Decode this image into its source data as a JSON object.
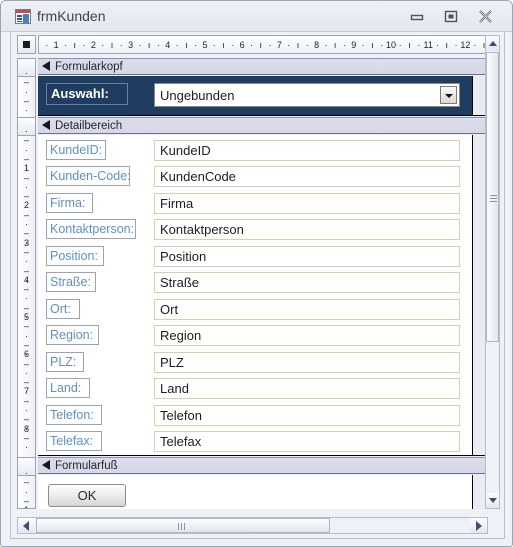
{
  "window": {
    "title": "frmKunden",
    "icon": "access-form-icon",
    "controls": {
      "minimize": "minimize-button",
      "restore": "restore-button",
      "close": "close-button"
    }
  },
  "rulers": {
    "horizontal_numbers": [
      1,
      2,
      3,
      4,
      5,
      6,
      7,
      8,
      9,
      10,
      11,
      12
    ],
    "vertical_numbers_detail": [
      1,
      2,
      3,
      4,
      5,
      6,
      7,
      8
    ],
    "vertical_numbers_footer": [
      1
    ],
    "unit": "cm"
  },
  "sections": [
    {
      "id": "header",
      "label": "Formularkopf"
    },
    {
      "id": "detail",
      "label": "Detailbereich"
    },
    {
      "id": "footer",
      "label": "Formularfuß"
    }
  ],
  "header": {
    "label": "Auswahl:",
    "combo": {
      "value": "Ungebunden",
      "arrow": "chevron-down-icon"
    }
  },
  "detail": {
    "rows": [
      {
        "label": "KundeID:",
        "field": "KundeID",
        "label_width": 60
      },
      {
        "label": "Kunden-Code:",
        "field": "KundenCode",
        "label_width": 84
      },
      {
        "label": "Firma:",
        "field": "Firma",
        "label_width": 47
      },
      {
        "label": "Kontaktperson:",
        "field": "Kontaktperson",
        "label_width": 90
      },
      {
        "label": "Position:",
        "field": "Position",
        "label_width": 58
      },
      {
        "label": "Straße:",
        "field": "Straße",
        "label_width": 50
      },
      {
        "label": "Ort:",
        "field": "Ort",
        "label_width": 34
      },
      {
        "label": "Region:",
        "field": "Region",
        "label_width": 53
      },
      {
        "label": "PLZ:",
        "field": "PLZ",
        "label_width": 38
      },
      {
        "label": "Land:",
        "field": "Land",
        "label_width": 44
      },
      {
        "label": "Telefon:",
        "field": "Telefon",
        "label_width": 56
      },
      {
        "label": "Telefax:",
        "field": "Telefax",
        "label_width": 56
      }
    ]
  },
  "footer": {
    "ok_button": "OK"
  },
  "scrollbars": {
    "vertical": {
      "up": "scroll-up-arrow",
      "down": "scroll-down-arrow"
    },
    "horizontal": {
      "left": "scroll-left-arrow",
      "right": "scroll-right-arrow"
    }
  },
  "colors": {
    "header_band": "#1f3c61",
    "label_text": "#5b8fd4",
    "field_border": "#d8cfb0",
    "section_bar": "#d8d9e8",
    "window_chrome": "#eef1f6"
  }
}
